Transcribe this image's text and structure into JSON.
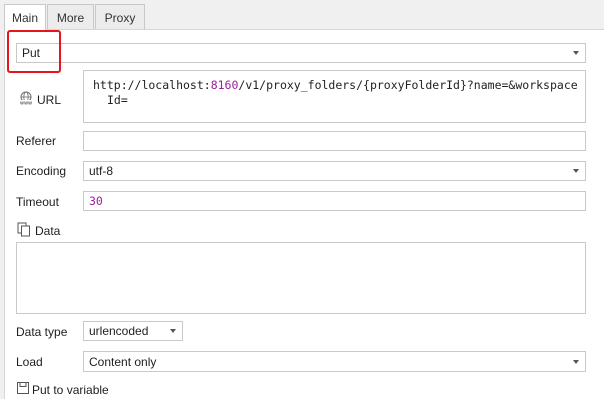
{
  "tabs": [
    {
      "label": "Main",
      "active": true
    },
    {
      "label": "More",
      "active": false
    },
    {
      "label": "Proxy",
      "active": false
    }
  ],
  "method": {
    "value": "Put"
  },
  "url": {
    "label": "URL",
    "prefix": "http://localhost:",
    "port": "8160",
    "suffix": "/v1/proxy_folders/{proxyFolderId}?name=&workspace",
    "line2": "Id="
  },
  "referer": {
    "label": "Referer",
    "value": ""
  },
  "encoding": {
    "label": "Encoding",
    "value": "utf-8"
  },
  "timeout": {
    "label": "Timeout",
    "value": "30"
  },
  "data": {
    "label": "Data",
    "value": ""
  },
  "data_type": {
    "label": "Data type",
    "value": "urlencoded"
  },
  "load": {
    "label": "Load",
    "value": "Content only"
  },
  "put_to_variable": {
    "label": "Put to variable"
  },
  "colors": {
    "highlight": "#e8141b",
    "number": "#9b1f9b",
    "border": "#c9c9c9"
  },
  "icons": {
    "url": "www-globe-icon",
    "data": "copy-pages-icon",
    "put_to_variable": "save-icon"
  }
}
